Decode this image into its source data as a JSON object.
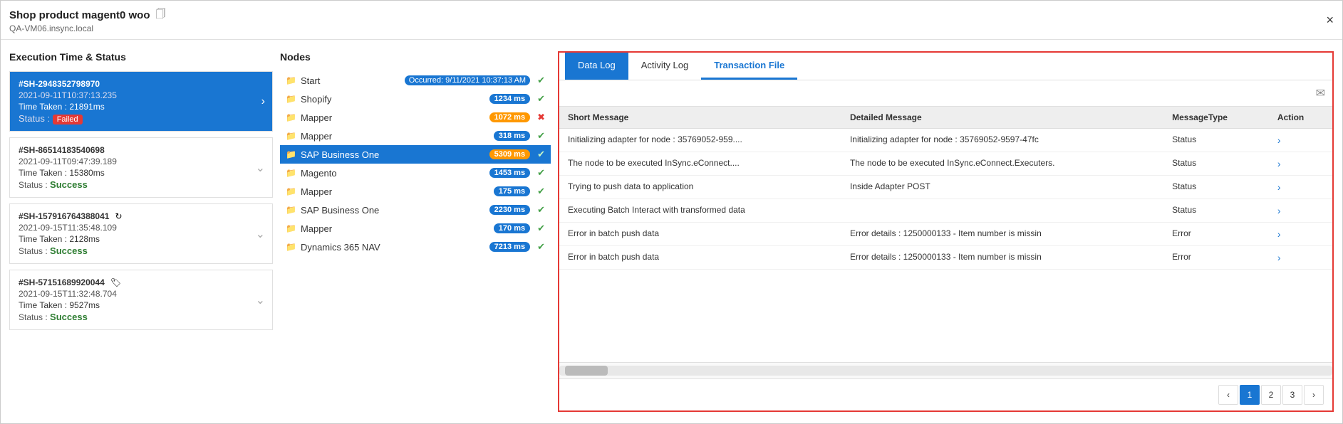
{
  "window": {
    "title": "Shop product magent0 woo",
    "subtitle": "QA-VM06.insync.local",
    "close_label": "×"
  },
  "left_panel": {
    "title": "Execution Time & Status",
    "items": [
      {
        "id": "#SH-2948352798970",
        "timestamp": "2021-09-11T10:37:13.235",
        "taken_label": "Time Taken : 21891ms",
        "status_label": "Status :",
        "status": "Failed",
        "active": true
      },
      {
        "id": "#SH-86514183540698",
        "timestamp": "2021-09-11T09:47:39.189",
        "taken_label": "Time Taken : 15380ms",
        "status_label": "Status :",
        "status": "Success",
        "active": false
      },
      {
        "id": "#SH-157916764388041",
        "timestamp": "2021-09-15T11:35:48.109",
        "taken_label": "Time Taken : 2128ms",
        "status_label": "Status :",
        "status": "Success",
        "active": false,
        "icon": "refresh"
      },
      {
        "id": "#SH-57151689920044",
        "timestamp": "2021-09-15T11:32:48.704",
        "taken_label": "Time Taken : 9527ms",
        "status_label": "Status :",
        "status": "Success",
        "active": false,
        "icon": "tag"
      }
    ]
  },
  "middle_panel": {
    "title": "Nodes",
    "nodes": [
      {
        "label": "Start",
        "badge": null,
        "badge_class": "",
        "status": "check",
        "note": "Occurred: 9/11/2021 10:37:13 AM",
        "active": false
      },
      {
        "label": "Shopify",
        "badge": "1234 ms",
        "badge_class": "badge-blue",
        "status": "check",
        "active": false
      },
      {
        "label": "Mapper",
        "badge": "1072 ms",
        "badge_class": "badge-orange",
        "status": "cross",
        "active": false
      },
      {
        "label": "Mapper",
        "badge": "318 ms",
        "badge_class": "badge-blue",
        "status": "check",
        "active": false
      },
      {
        "label": "SAP Business One",
        "badge": "5309 ms",
        "badge_class": "badge-blue",
        "status": "check",
        "active": true
      },
      {
        "label": "Magento",
        "badge": "1453 ms",
        "badge_class": "badge-blue",
        "status": "check",
        "active": false
      },
      {
        "label": "Mapper",
        "badge": "175 ms",
        "badge_class": "badge-blue",
        "status": "check",
        "active": false
      },
      {
        "label": "SAP Business One",
        "badge": "2230 ms",
        "badge_class": "badge-blue",
        "status": "check",
        "active": false
      },
      {
        "label": "Mapper",
        "badge": "170 ms",
        "badge_class": "badge-blue",
        "status": "check",
        "active": false
      },
      {
        "label": "Dynamics 365 NAV",
        "badge": "7213 ms",
        "badge_class": "badge-blue",
        "status": "check",
        "active": false
      }
    ]
  },
  "right_panel": {
    "tabs": [
      {
        "label": "Data Log",
        "active": "blue"
      },
      {
        "label": "Activity Log",
        "active": "none"
      },
      {
        "label": "Transaction File",
        "active": "outline"
      }
    ],
    "filter_placeholder": "",
    "table": {
      "columns": [
        "Short Message",
        "Detailed Message",
        "MessageType",
        "Action"
      ],
      "rows": [
        {
          "short": "Initializing adapter for node : 35769052-959....",
          "detailed": "Initializing adapter for node : 35769052-9597-47fc",
          "type": "Status",
          "action": "›"
        },
        {
          "short": "The node to be executed InSync.eConnect....",
          "detailed": "The node to be executed InSync.eConnect.Executers.",
          "type": "Status",
          "action": "›"
        },
        {
          "short": "Trying to push data to application",
          "detailed": "Inside Adapter POST",
          "type": "Status",
          "action": "›"
        },
        {
          "short": "Executing Batch Interact with transformed data",
          "detailed": "",
          "type": "Status",
          "action": "›"
        },
        {
          "short": "Error in batch push data",
          "detailed": "Error details : 1250000133 - Item number is missin",
          "type": "Error",
          "action": "›"
        },
        {
          "short": "Error in batch push data",
          "detailed": "Error details : 1250000133 - Item number is missin",
          "type": "Error",
          "action": "›"
        }
      ]
    },
    "pagination": {
      "prev": "‹",
      "pages": [
        "1",
        "2",
        "3"
      ],
      "next": "›",
      "active_page": "1"
    }
  }
}
